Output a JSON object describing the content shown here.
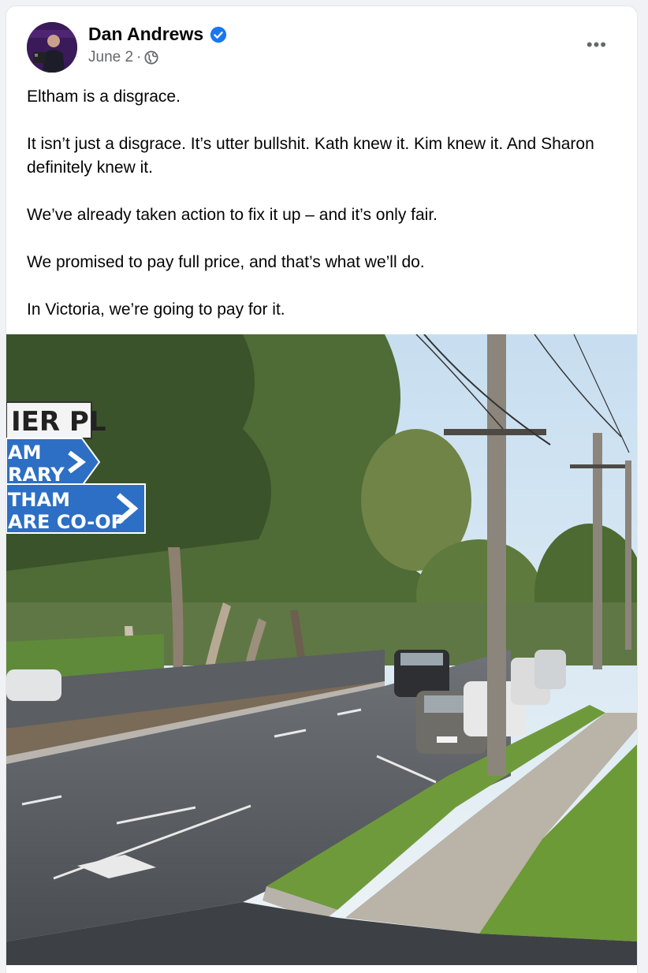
{
  "post": {
    "author": "Dan Andrews",
    "verified_icon": "verified-badge-icon",
    "date": "June 2",
    "separator": "·",
    "audience_icon": "globe-icon",
    "more_icon": "more-options-icon",
    "more_label": "•••",
    "paragraphs": [
      "Eltham is a disgrace.",
      "It isn’t just a disgrace. It’s utter bullshit. Kath knew it. Kim knew it. And Sharon definitely knew it.",
      "We’ve already taken action to fix it up – and it’s only fair.",
      "We promised to pay full price, and that’s what we’ll do.",
      "In Victoria, we’re going to pay for it."
    ]
  },
  "photo": {
    "signs": {
      "top": "IER PL",
      "middle_line1": "AM",
      "middle_line2": "RARY",
      "bottom_line1": "THAM",
      "bottom_line2": "ARE CO-OP"
    }
  },
  "colors": {
    "accent": "#1877f2",
    "text": "#050505",
    "secondary": "#65676b",
    "background": "#f0f2f5"
  }
}
